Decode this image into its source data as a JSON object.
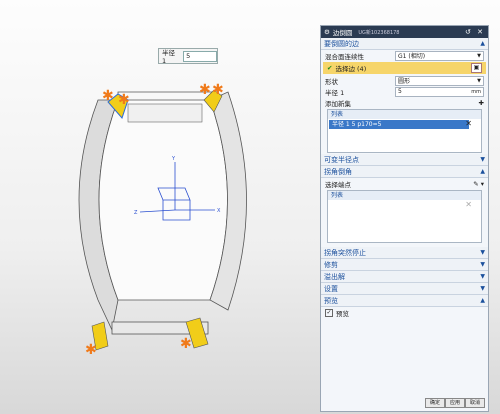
{
  "viewport": {
    "radius_label": "半径 1",
    "radius_value": "5",
    "accent_colors": {
      "fillet": "#f1cd19",
      "handle": "#f07a1a",
      "edge": "#2a6ad8"
    }
  },
  "dialog": {
    "title": "边倒圆",
    "subtitle": "UG新102368178",
    "controls": "↺ ✕",
    "sections": {
      "edges": "要倒圆的边",
      "variable_radius": "可变半径点",
      "corner_setback": "拐角倒角",
      "corner_stop": "拐角突然停止",
      "trim": "修剪",
      "overflow": "溢出解",
      "settings": "设置",
      "preview": "预览"
    },
    "blend_continuity_label": "混合面连续性",
    "blend_continuity_value": "G1 (相切)",
    "select_edge_label": "选择边 (4)",
    "shape_label": "形状",
    "shape_value": "圆形",
    "radius1_label": "半径 1",
    "radius1_value": "5",
    "radius_unit": "mm",
    "add_new_set_label": "添加新集",
    "list_header": "列表",
    "list_row": "半径 1  5  p170=5",
    "select_endpoint_label": "选择端点",
    "list2_header": "列表",
    "preview_checkbox_label": "预览",
    "ok_label": "确定",
    "apply_label": "应用",
    "cancel_label": "取消"
  }
}
